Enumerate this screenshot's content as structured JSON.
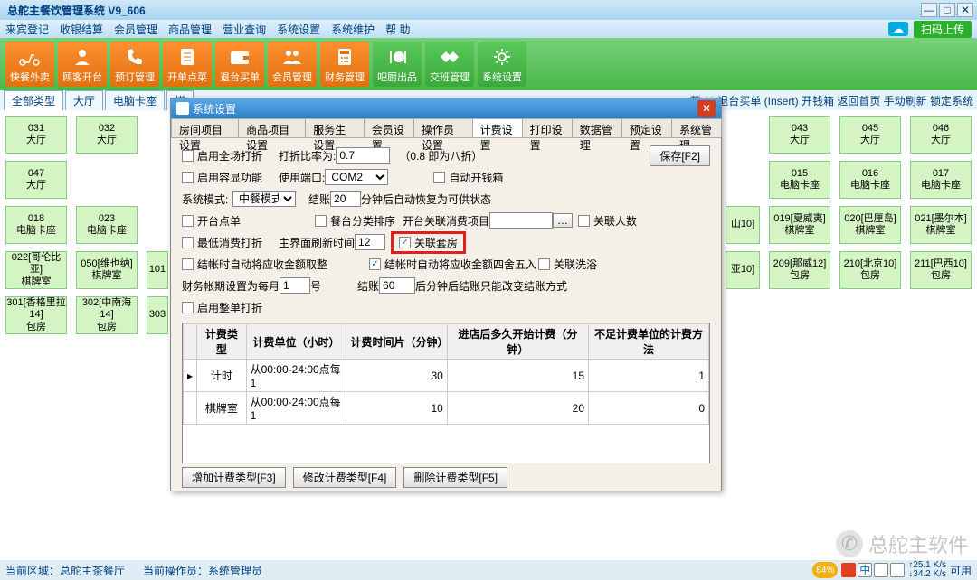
{
  "titlebar": {
    "title": "总舵主餐饮管理系统  V9_606"
  },
  "menubar": {
    "items": [
      "来宾登记",
      "收银结算",
      "会员管理",
      "商品管理",
      "营业查询",
      "系统设置",
      "系统维护",
      "帮 助"
    ],
    "upload": "扫码上传"
  },
  "toolbar": {
    "items": [
      {
        "label": "快餐外卖"
      },
      {
        "label": "顾客开台"
      },
      {
        "label": "预订管理"
      },
      {
        "label": "开单点菜"
      },
      {
        "label": "退台买单"
      },
      {
        "label": "会员管理"
      },
      {
        "label": "财务管理"
      },
      {
        "label": "吧厨出品"
      },
      {
        "label": "交班管理"
      },
      {
        "label": "系统设置"
      }
    ]
  },
  "filterbar": {
    "tabs": [
      "全部类型",
      "大厅",
      "电脑卡座",
      "棋"
    ],
    "right": "菜 (-) 退台买单 (Insert) 开钱箱 返回首页 手动刷新 锁定系统"
  },
  "desks": {
    "row0": [
      {
        "n": "031",
        "r": "大厅"
      },
      {
        "n": "032",
        "r": "大厅"
      }
    ],
    "row0_right": [
      {
        "n": "043",
        "r": "大厅"
      },
      {
        "n": "045",
        "r": "大厅"
      },
      {
        "n": "046",
        "r": "大厅"
      }
    ],
    "row1": [
      {
        "n": "047",
        "r": "大厅"
      }
    ],
    "row1_right": [
      {
        "n": "015",
        "r": "电脑卡座"
      },
      {
        "n": "016",
        "r": "电脑卡座"
      },
      {
        "n": "017",
        "r": "电脑卡座"
      }
    ],
    "row2": [
      {
        "n": "018",
        "r": "电脑卡座"
      },
      {
        "n": "023",
        "r": "电脑卡座"
      }
    ],
    "row2_right": [
      {
        "n": "山10]",
        "r": ""
      },
      {
        "n": "019[夏威夷]",
        "r": "棋牌室"
      },
      {
        "n": "020[巴厘岛]",
        "r": "棋牌室"
      },
      {
        "n": "021[墨尔本]",
        "r": "棋牌室"
      }
    ],
    "row3": [
      {
        "n": "022[哥伦比亚]",
        "r": "棋牌室"
      },
      {
        "n": "050[维也纳]",
        "r": "棋牌室"
      },
      {
        "n": "101",
        "r": ""
      }
    ],
    "row3_right": [
      {
        "n": "亚10]",
        "r": ""
      },
      {
        "n": "209[那威12]",
        "r": "包房"
      },
      {
        "n": "210[北京10]",
        "r": "包房"
      },
      {
        "n": "211[巴西10]",
        "r": "包房"
      }
    ],
    "row4": [
      {
        "n": "301[香格里拉14]",
        "r": "包房"
      },
      {
        "n": "302[中南海14]",
        "r": "包房"
      },
      {
        "n": "303",
        "r": ""
      }
    ]
  },
  "dialog": {
    "title": "系统设置",
    "tabs": [
      "房间项目设置",
      "商品项目设置",
      "服务生设置",
      "会员设置",
      "操作员设置",
      "计费设置",
      "打印设置",
      "数据管理",
      "预定设置",
      "系统管理"
    ],
    "active_tab": 5,
    "form": {
      "cb_qycz": "启用全场打折",
      "lbl_zkbl": "打折比率为:",
      "val_zkbl": "0.7",
      "hint_zkbl": "（0.8 即为八折）",
      "btn_save": "保存[F2]",
      "cb_qyrx": "启用容显功能",
      "lbl_port": "使用端口:",
      "val_port": "COM2",
      "cb_autocash": "自动开钱箱",
      "lbl_mode": "系统模式:",
      "val_mode": "中餐模式",
      "lbl_jz": "结账",
      "val_jz": "20",
      "hint_jz": "分钟后自动恢复为可供状态",
      "cb_ktdc": "开台点单",
      "cb_ctsort": "餐台分类排序",
      "lbl_ktgl": "开台关联消费项目",
      "val_ktgl": "…",
      "cb_glrs": "关联人数",
      "cb_zdxf": "最低消费打折",
      "lbl_refresh": "主界面刷新时间",
      "val_refresh": "12",
      "cb_glth": "关联套房",
      "cb_jzqs": "结帐时自动将应收金额取整",
      "cb_jzss": "结帐时自动将应收金额四舍五入",
      "cb_glxy": "关联洗浴",
      "lbl_cwzq": "财务帐期设置为每月",
      "val_cwzq": "1",
      "lbl_hao": "号",
      "lbl_jz2": "结账",
      "val_jz2": "60",
      "hint_jz2": "后分钟后结账只能改变结账方式",
      "cb_zddz": "启用整单打折"
    },
    "grid": {
      "headers": [
        "计费类型",
        "计费单位（小时）",
        "计费时间片（分钟）",
        "进店后多久开始计费（分钟）",
        "不足计费单位的计费方法"
      ],
      "rows": [
        [
          "计时",
          "从00:00-24:00点每1",
          "30",
          "15",
          "1"
        ],
        [
          "棋牌室",
          "从00:00-24:00点每1",
          "10",
          "20",
          "0"
        ]
      ]
    },
    "buttons": {
      "add": "增加计费类型[F3]",
      "edit": "修改计费类型[F4]",
      "del": "删除计费类型[F5]"
    }
  },
  "statusbar": {
    "area_lbl": "当前区域：",
    "area_val": "总舵主茶餐厅",
    "op_lbl": "当前操作员：",
    "op_val": "系统管理员",
    "pct": "84%",
    "net_up": "↑25.1 K/s",
    "net_dn": "↓34.2 K/s",
    "avail": "可用"
  },
  "watermark": "总舵主软件"
}
